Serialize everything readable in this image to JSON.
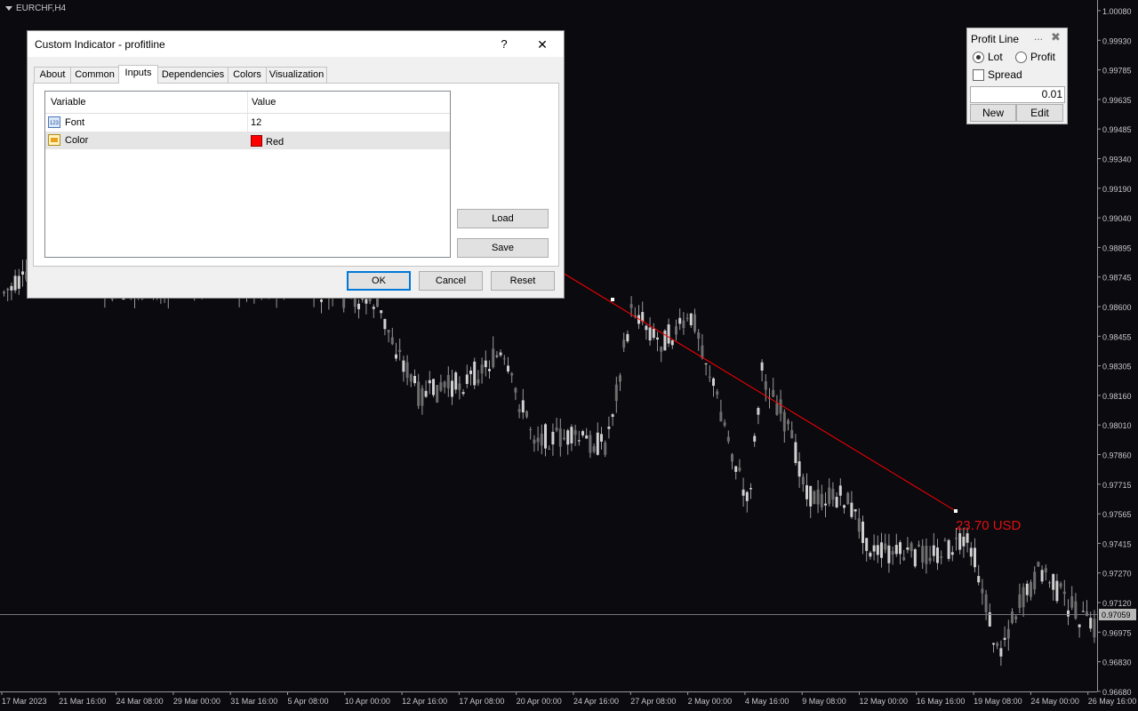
{
  "chart": {
    "symbol": "EURCHF,H4",
    "prices": [
      "1.00080",
      "0.99930",
      "0.99785",
      "0.99635",
      "0.99485",
      "0.99340",
      "0.99190",
      "0.99040",
      "0.98895",
      "0.98745",
      "0.98600",
      "0.98455",
      "0.98305",
      "0.98160",
      "0.98010",
      "0.97860",
      "0.97715",
      "0.97565",
      "0.97415",
      "0.97270",
      "0.97120",
      "0.96975",
      "0.96830",
      "0.96680"
    ],
    "current_price": "0.97059",
    "dates": [
      "17 Mar 2023",
      "21 Mar 16:00",
      "24 Mar 08:00",
      "29 Mar 00:00",
      "31 Mar 16:00",
      "5 Apr 08:00",
      "10 Apr 00:00",
      "12 Apr 16:00",
      "17 Apr 08:00",
      "20 Apr 00:00",
      "24 Apr 16:00",
      "27 Apr 08:00",
      "2 May 00:00",
      "4 May 16:00",
      "9 May 08:00",
      "12 May 00:00",
      "16 May 16:00",
      "19 May 08:00",
      "24 May 00:00",
      "26 May 16:00"
    ],
    "profit_label": "23.70 USD",
    "line_color": "#ff0000"
  },
  "dialog": {
    "title": "Custom Indicator - profitline",
    "help": "?",
    "close": "✕",
    "tabs": [
      "About",
      "Common",
      "Inputs",
      "Dependencies",
      "Colors",
      "Visualization"
    ],
    "active_tab": "Inputs",
    "columns": [
      "Variable",
      "Value"
    ],
    "rows": [
      {
        "name": "Font",
        "value": "12",
        "icon": "integer-icon"
      },
      {
        "name": "Color",
        "value": "Red",
        "icon": "color-icon"
      }
    ],
    "load": "Load",
    "save": "Save",
    "ok": "OK",
    "cancel": "Cancel",
    "reset": "Reset"
  },
  "profit_panel": {
    "title": "Profit Line",
    "minimize": "...",
    "close": "✖",
    "lot": "Lot",
    "profit": "Profit",
    "spread": "Spread",
    "value": "0.01",
    "new": "New",
    "edit": "Edit"
  }
}
